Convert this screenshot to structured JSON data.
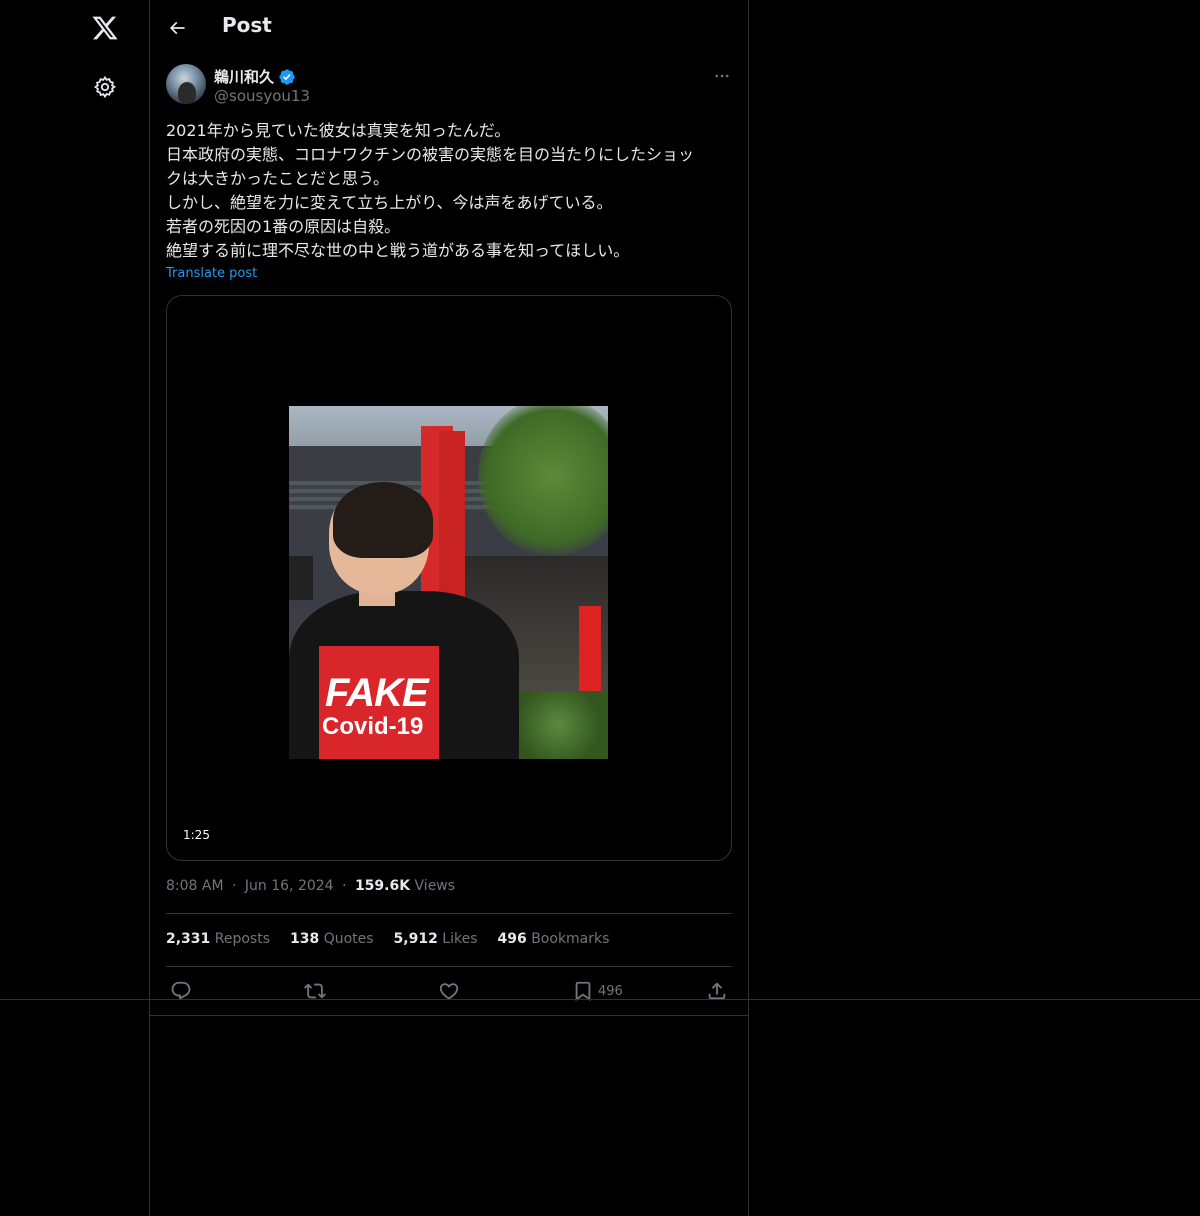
{
  "sidebar": {
    "logo_icon": "x-logo-icon",
    "settings_icon": "gear-icon"
  },
  "header": {
    "back_icon": "arrow-left-icon",
    "title": "Post"
  },
  "author": {
    "name": "鵜川和久",
    "handle": "@sousyou13",
    "verified_icon": "verified-badge-icon",
    "more_icon": "more-horizontal-icon"
  },
  "post": {
    "lines": [
      "2021年から見ていた彼女は真実を知ったんだ。",
      "日本政府の実態、コロナワクチンの被害の実態を目の当たりにしたショッ",
      "クは大きかったことだと思う。",
      "しかし、絶望を力に変えて立ち上がり、今は声をあげている。",
      "若者の死因の1番の原因は自殺。",
      "絶望する前に理不尽な世の中と戦う道がある事を知ってほしい。"
    ],
    "translate_label": "Translate post",
    "video": {
      "duration": "1:25",
      "shirt_text_1": "FAKE",
      "shirt_text_2": "Covid-19"
    }
  },
  "meta": {
    "time": "8:08 AM",
    "separator": "·",
    "date": "Jun 16, 2024",
    "views_count": "159.6K",
    "views_label": "Views"
  },
  "stats": {
    "reposts_count": "2,331",
    "reposts_label": "Reposts",
    "quotes_count": "138",
    "quotes_label": "Quotes",
    "likes_count": "5,912",
    "likes_label": "Likes",
    "bookmarks_count": "496",
    "bookmarks_label": "Bookmarks"
  },
  "actions": {
    "reply_icon": "reply-icon",
    "repost_icon": "repost-icon",
    "like_icon": "heart-icon",
    "bookmark_icon": "bookmark-icon",
    "bookmark_count": "496",
    "share_icon": "share-icon"
  },
  "colors": {
    "background": "#000000",
    "text": "#e7e9ea",
    "muted": "#71767b",
    "accent": "#1d9bf0",
    "border": "#2f3336"
  }
}
